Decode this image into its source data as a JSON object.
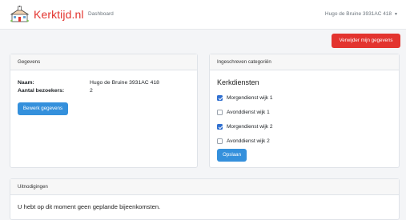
{
  "navbar": {
    "brand": "Kerktijd.nl",
    "dashboard_link": "Dashboard",
    "user_name": "Hugo de Bruine 3931AC 418"
  },
  "actions": {
    "delete_label": "Verwijder mijn gegevens"
  },
  "gegevens": {
    "header": "Gegevens",
    "name_label": "Naam:",
    "name_value": "Hugo de Bruine 3931AC 418",
    "visitors_label": "Aantal bezoekers:",
    "visitors_value": "2",
    "edit_label": "Bewerk gegevens"
  },
  "categories": {
    "header": "Ingeschreven categoriën",
    "title": "Kerkdiensten",
    "items": [
      {
        "label": "Morgendienst wijk 1",
        "checked": true
      },
      {
        "label": "Avonddienst wijk 1",
        "checked": false
      },
      {
        "label": "Morgendienst wijk 2",
        "checked": true
      },
      {
        "label": "Avonddienst wijk 2",
        "checked": false
      }
    ],
    "save_label": "Opslaan"
  },
  "invitations": {
    "header": "Uitnodigingen",
    "message": "U hebt op dit moment geen geplande bijeenkomsten."
  },
  "colors": {
    "brand": "#e3342f",
    "primary": "#3490dc",
    "checked": "#2f6fd0"
  }
}
